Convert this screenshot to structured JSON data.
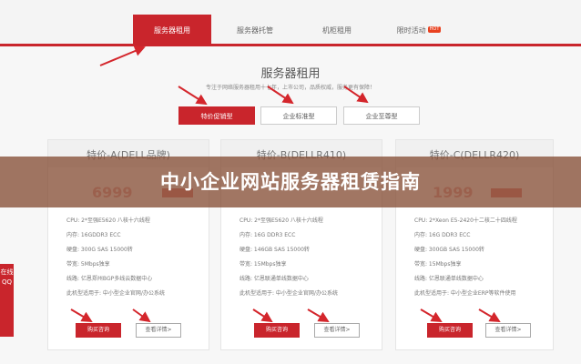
{
  "nav": {
    "tabs": [
      {
        "label": "服务器租用",
        "active": true
      },
      {
        "label": "服务器托管",
        "active": false
      },
      {
        "label": "机柜租用",
        "active": false
      },
      {
        "label": "限时活动",
        "active": false,
        "badge": "HOT"
      }
    ]
  },
  "header": {
    "title": "服务器租用",
    "subtitle": "专注于网络服务器租用十七年，上市公司，品质权威，服务更有保障！"
  },
  "filters": [
    {
      "label": "特价促销型",
      "active": true
    },
    {
      "label": "企业标准型",
      "active": false
    },
    {
      "label": "企业至尊型",
      "active": false
    }
  ],
  "cards": [
    {
      "title": "特价-A(DELL品牌)",
      "price": "6999",
      "specs": [
        "CPU: 2*至强E5620 八核十六线程",
        "内存: 16GDDR3 ECC",
        "硬盘: 300G SAS 15000转",
        "带宽: 5Mbps独享",
        "线路: 亿恩郑州BGP多线云数据中心",
        "此机型适用于: 中小型企业官网/办公系统"
      ],
      "buy_label": "购买咨询",
      "detail_label": "查看详情>"
    },
    {
      "title": "特价-B(DELLR410)",
      "price": "",
      "specs": [
        "CPU: 2*至强E5620 八核十六线程",
        "内存: 16G DDR3 ECC",
        "硬盘: 146GB SAS 15000转",
        "带宽: 15Mbps独享",
        "线路: 亿恩联通单线数据中心",
        "此机型适用于: 中小型企业官网/办公系统"
      ],
      "buy_label": "购买咨询",
      "detail_label": "查看详情>"
    },
    {
      "title": "特价-C(DELLR420)",
      "price": "1999",
      "specs": [
        "CPU: 2*Xeon E5-2420十二核二十四线程",
        "内存: 16G DDR3 ECC",
        "硬盘: 300GB SAS 15000转",
        "带宽: 15Mbps独享",
        "线路: 亿恩联通单线数据中心",
        "此机型适用于: 中小型企业ERP等软件使用"
      ],
      "buy_label": "购买咨询",
      "detail_label": "查看详情>"
    }
  ],
  "banner": "中小企业网站服务器租赁指南",
  "float_widget": "在线QQ",
  "colors": {
    "accent": "#c9252c",
    "banner": "#875037"
  }
}
